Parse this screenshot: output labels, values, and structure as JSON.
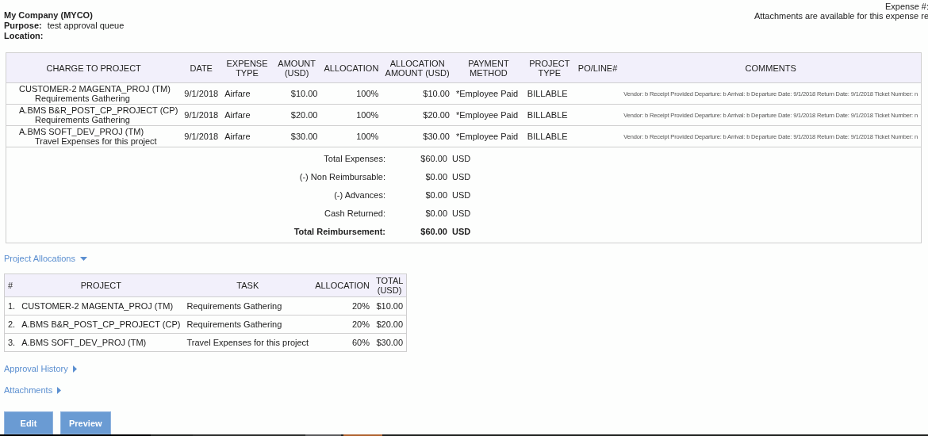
{
  "header": {
    "company": "My Company (MYCO)",
    "purpose_label": "Purpose:",
    "purpose": "test approval queue",
    "location_label": "Location:",
    "expense_number_label": "Expense #:",
    "attachments_note": "Attachments are available for this expense re"
  },
  "expense_table": {
    "columns": [
      "CHARGE TO PROJECT",
      "DATE",
      "EXPENSE TYPE",
      "AMOUNT (USD)",
      "ALLOCATION",
      "ALLOCATION AMOUNT (USD)",
      "PAYMENT METHOD",
      "PROJECT TYPE",
      "PO/LINE#",
      "COMMENTS"
    ],
    "rows": [
      {
        "project": "CUSTOMER-2 MAGENTA_PROJ (TM)",
        "task": "Requirements Gathering",
        "date": "9/1/2018",
        "expense_type": "Airfare",
        "amount": "$10.00",
        "allocation": "100%",
        "allocation_amount": "$10.00",
        "payment_method": "*Employee Paid",
        "project_type": "BILLABLE",
        "comments": "Vendor: b Receipt Provided Departure: b Arrival: b Departure Date: 9/1/2018 Return Date: 9/1/2018 Ticket Number: n"
      },
      {
        "project": "A.BMS B&R_POST_CP_PROJECT (CP)",
        "task": "Requirements Gathering",
        "date": "9/1/2018",
        "expense_type": "Airfare",
        "amount": "$20.00",
        "allocation": "100%",
        "allocation_amount": "$20.00",
        "payment_method": "*Employee Paid",
        "project_type": "BILLABLE",
        "comments": "Vendor: b Receipt Provided Departure: b Arrival: b Departure Date: 9/1/2018 Return Date: 9/1/2018 Ticket Number: n"
      },
      {
        "project": "A.BMS SOFT_DEV_PROJ (TM)",
        "task": "Travel Expenses for this project",
        "date": "9/1/2018",
        "expense_type": "Airfare",
        "amount": "$30.00",
        "allocation": "100%",
        "allocation_amount": "$30.00",
        "payment_method": "*Employee Paid",
        "project_type": "BILLABLE",
        "comments": "Vendor: b Receipt Provided Departure: b Arrival: b Departure Date: 9/1/2018 Return Date: 9/1/2018 Ticket Number: n"
      }
    ],
    "totals": [
      {
        "kind": "line",
        "label": "Total Expenses:",
        "amount": "$60.00",
        "currency": "USD"
      },
      {
        "kind": "line",
        "label": "(-) Non Reimbursable:",
        "amount": "$0.00",
        "currency": "USD"
      },
      {
        "kind": "line",
        "label": "(-) Advances:",
        "amount": "$0.00",
        "currency": "USD"
      },
      {
        "kind": "line",
        "label": "Cash Returned:",
        "amount": "$0.00",
        "currency": "USD"
      },
      {
        "kind": "grand",
        "label": "Total Reimbursement:",
        "amount": "$60.00",
        "currency": "USD"
      }
    ]
  },
  "sections": [
    {
      "title": "Project Allocations",
      "expanded": true,
      "table": {
        "columns": [
          "#",
          "PROJECT",
          "TASK",
          "ALLOCATION",
          "TOTAL (USD)"
        ],
        "rows": [
          {
            "number": "1.",
            "project": "CUSTOMER-2 MAGENTA_PROJ (TM)",
            "task": "Requirements Gathering",
            "allocation": "20%",
            "total": "$10.00"
          },
          {
            "number": "2.",
            "project": "A.BMS B&R_POST_CP_PROJECT (CP)",
            "task": "Requirements Gathering",
            "allocation": "20%",
            "total": "$20.00"
          },
          {
            "number": "3.",
            "project": "A.BMS SOFT_DEV_PROJ (TM)",
            "task": "Travel Expenses for this project",
            "allocation": "60%",
            "total": "$30.00"
          }
        ]
      }
    },
    {
      "title": "Approval History",
      "expanded": false
    },
    {
      "title": "Attachments",
      "expanded": false
    }
  ],
  "buttons": [
    "Edit",
    "Preview"
  ]
}
